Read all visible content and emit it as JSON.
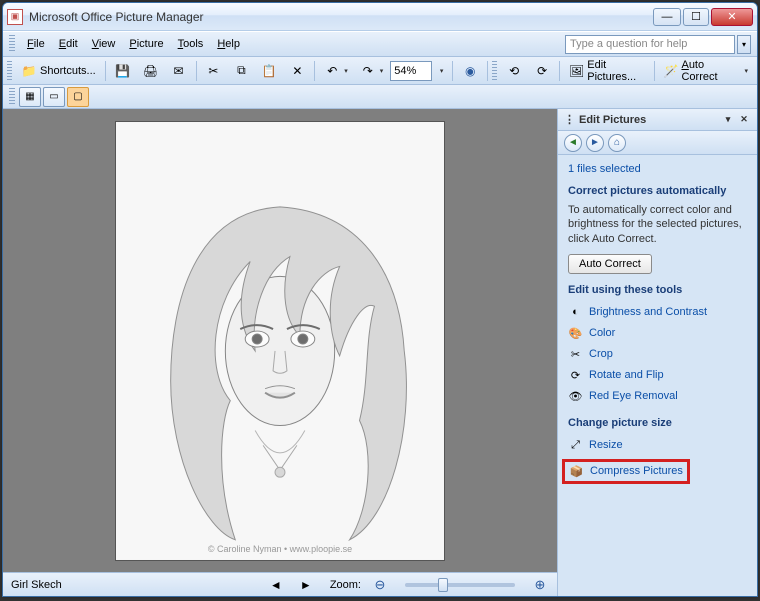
{
  "window": {
    "title": "Microsoft Office Picture Manager"
  },
  "menu": {
    "file": "File",
    "edit": "Edit",
    "view": "View",
    "picture": "Picture",
    "tools": "Tools",
    "help": "Help",
    "help_placeholder": "Type a question for help"
  },
  "toolbar": {
    "shortcuts": "Shortcuts...",
    "zoom_value": "54%",
    "edit_pictures": "Edit Pictures...",
    "auto_correct": "Auto Correct"
  },
  "status": {
    "filename": "Girl Skech",
    "zoom_label": "Zoom:"
  },
  "image": {
    "watermark": "© Caroline Nyman • www.ploopie.se"
  },
  "panel": {
    "title": "Edit Pictures",
    "files_selected": "1 files selected",
    "correct_heading": "Correct pictures automatically",
    "correct_desc": "To automatically correct color and brightness for the selected pictures, click Auto Correct.",
    "auto_correct_btn": "Auto Correct",
    "tools_heading": "Edit using these tools",
    "tools": {
      "brightness": "Brightness and Contrast",
      "color": "Color",
      "crop": "Crop",
      "rotate": "Rotate and Flip",
      "redeye": "Red Eye Removal"
    },
    "size_heading": "Change picture size",
    "resize": "Resize",
    "compress": "Compress Pictures"
  }
}
